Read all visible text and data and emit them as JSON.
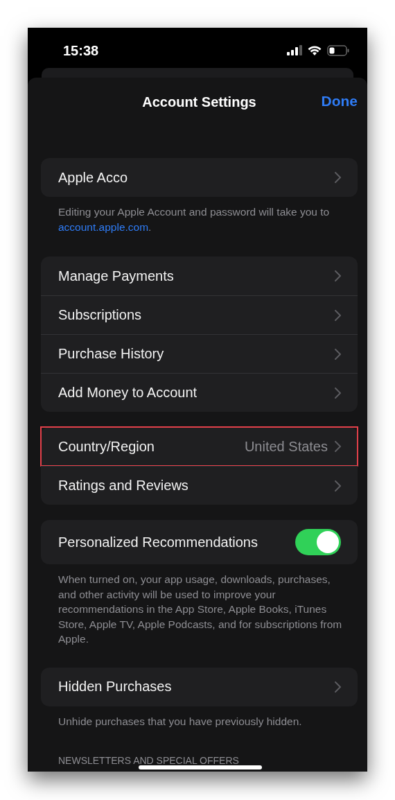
{
  "status_bar": {
    "time": "15:38"
  },
  "nav": {
    "title": "Account Settings",
    "done": "Done"
  },
  "sections": [
    {
      "rows": [
        {
          "kind": "link",
          "label": "Apple Acco",
          "highlighted": false
        }
      ],
      "footer": {
        "before": "Editing your Apple Account and password will take you to ",
        "link": "account.apple.com",
        "after": "."
      }
    },
    {
      "rows": [
        {
          "kind": "link",
          "label": "Manage Payments",
          "highlighted": false
        },
        {
          "kind": "link",
          "label": "Subscriptions",
          "highlighted": false
        },
        {
          "kind": "link",
          "label": "Purchase History",
          "highlighted": false
        },
        {
          "kind": "link",
          "label": "Add Money to Account",
          "highlighted": false
        }
      ]
    },
    {
      "rows": [
        {
          "kind": "link",
          "label": "Country/Region",
          "value": "United States",
          "highlighted": true
        },
        {
          "kind": "link",
          "label": "Ratings and Reviews",
          "highlighted": false
        }
      ]
    },
    {
      "rows": [
        {
          "kind": "toggle",
          "label": "Personalized Recommendations",
          "on": true,
          "highlighted": false
        }
      ],
      "footer": {
        "before": "When turned on, your app usage, downloads, purchases, and other activity will be used to improve your recommendations in the App Store, Apple Books, iTunes Store, Apple TV, Apple Podcasts, and for subscriptions from Apple."
      }
    },
    {
      "rows": [
        {
          "kind": "link",
          "label": "Hidden Purchases",
          "highlighted": false
        }
      ],
      "footer": {
        "before": "Unhide purchases that you have previously hidden."
      }
    }
  ],
  "section_header": "NEWSLETTERS AND SPECIAL OFFERS"
}
